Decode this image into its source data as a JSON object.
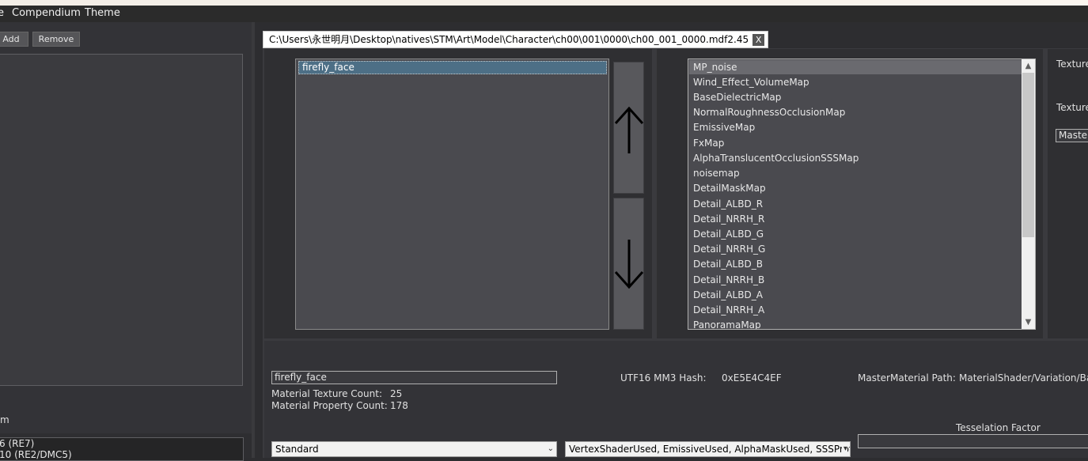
{
  "menubar": {
    "items": [
      "Compendium",
      "Theme"
    ]
  },
  "left": {
    "add_label": "Add",
    "remove_label": "Remove",
    "section_label_tail": "m",
    "bottom_list": [
      "6 (RE7)",
      "10 (RE2/DMC5)"
    ]
  },
  "tab": {
    "title": "C:\\Users\\永世明月\\Desktop\\natives\\STM\\Art\\Model\\Character\\ch00\\001\\0000\\ch00_001_0000.mdf2.45",
    "close_label": "X"
  },
  "materials": {
    "items": [
      "firefly_face"
    ],
    "move_up_glyph": "↑",
    "move_down_glyph": "↓"
  },
  "textures": {
    "items": [
      "MP_noise",
      "Wind_Effect_VolumeMap",
      "BaseDielectricMap",
      "NormalRoughnessOcclusionMap",
      "EmissiveMap",
      "FxMap",
      "AlphaTranslucentOcclusionSSSMap",
      "noisemap",
      "DetailMaskMap",
      "Detail_ALBD_R",
      "Detail_NRRH_R",
      "Detail_ALBD_G",
      "Detail_NRRH_G",
      "Detail_ALBD_B",
      "Detail_NRRH_B",
      "Detail_ALBD_A",
      "Detail_NRRH_A",
      "PanoramaMap"
    ]
  },
  "texture_panel": {
    "label1": "Texture",
    "label2": "Texture",
    "field_value": "Master"
  },
  "details": {
    "name_value": "firefly_face",
    "texture_count_label": "Material Texture Count:",
    "texture_count": "25",
    "property_count_label": "Material Property Count:",
    "property_count": "178",
    "hash_label": "UTF16 MM3 Hash:",
    "hash_value": "0xE5E4C4EF",
    "mm_path_label": "MasterMaterial Path:",
    "mm_path_value": "MaterialShader/Variation/Ba",
    "type_value": "Standard",
    "flags_value": "VertexShaderUsed, EmissiveUsed, AlphaMaskUsed, SSSProf",
    "tess_label": "Tesselation Factor"
  }
}
